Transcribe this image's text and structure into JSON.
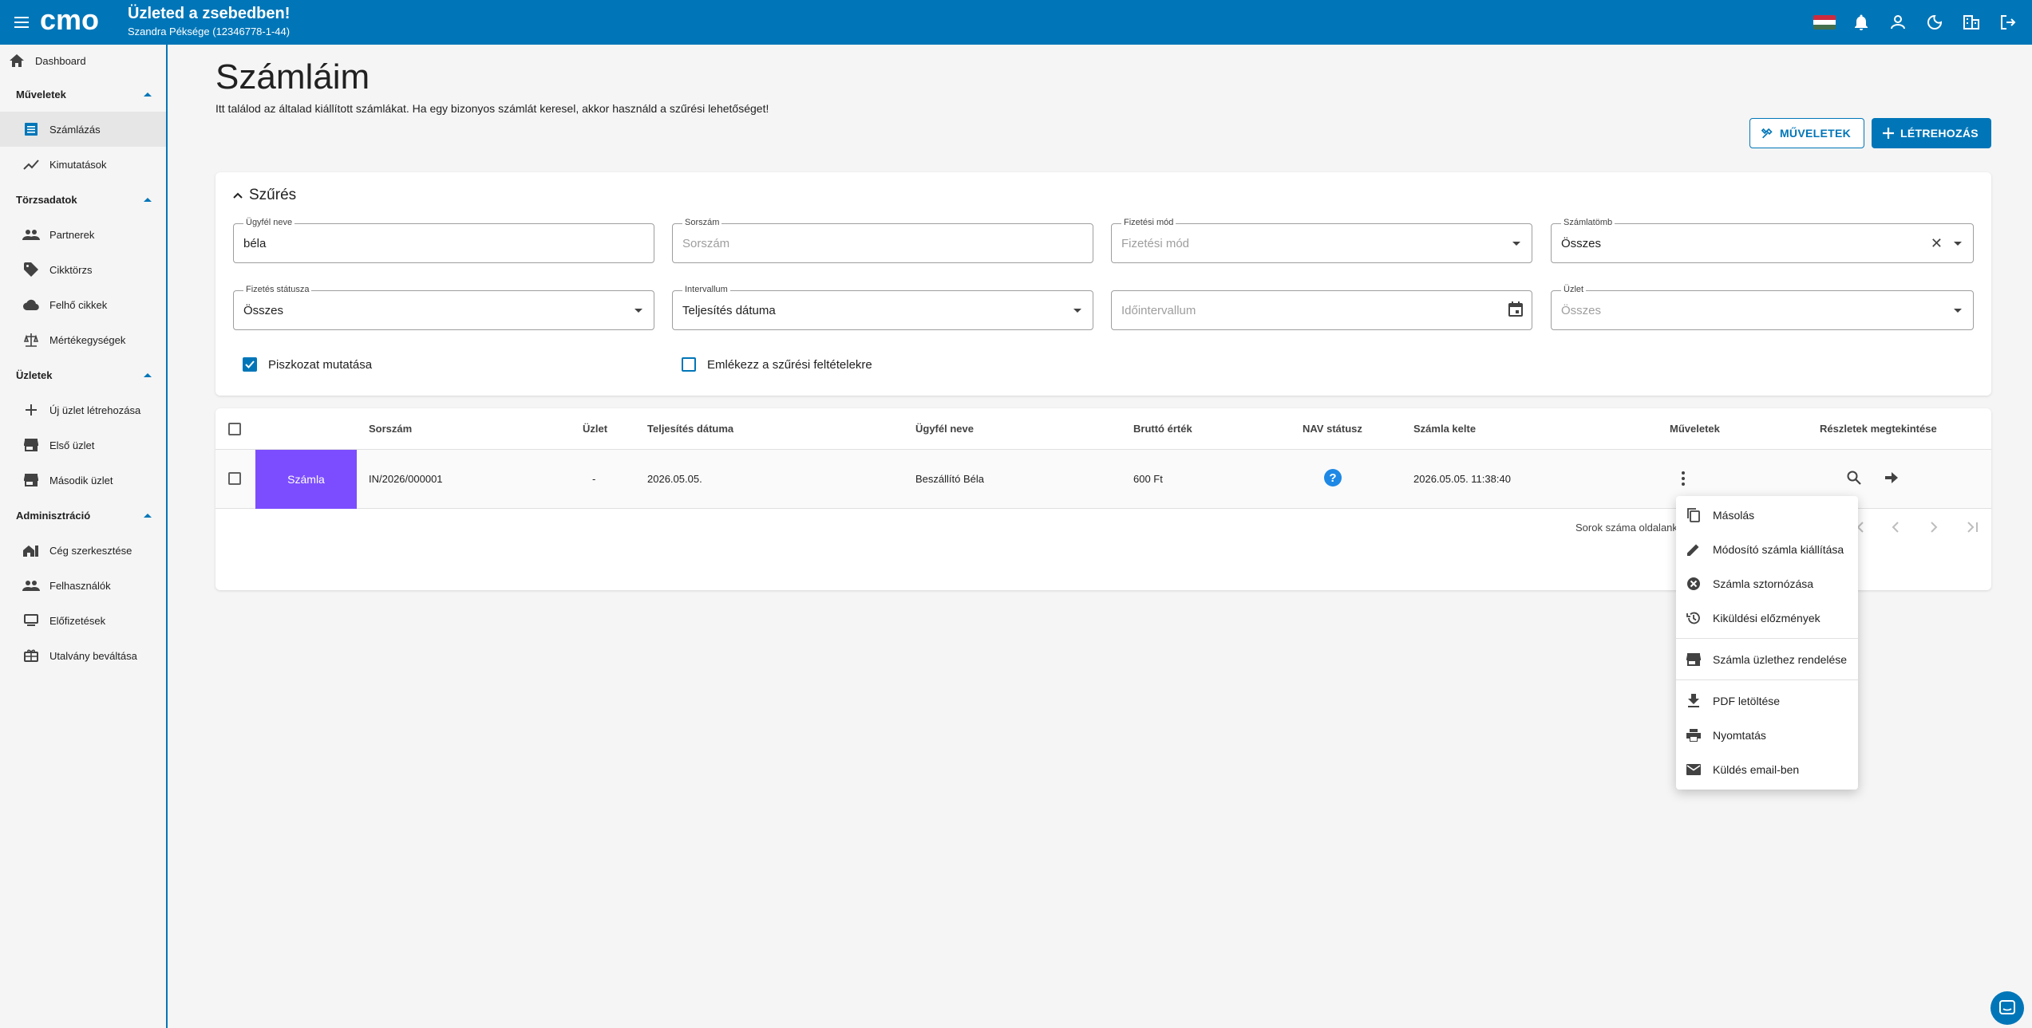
{
  "header": {
    "title": "Üzleted a zsebedben!",
    "subtitle": "Szandra Péksége (12346778-1-44)",
    "logo_text": "cmo",
    "brand_color": "#0076b8",
    "icons": [
      "hungarian-flag-icon",
      "bell-icon",
      "account-icon",
      "dark-mode-icon",
      "company-icon",
      "logout-icon"
    ]
  },
  "sidebar": {
    "dashboard": "Dashboard",
    "sections": [
      {
        "label": "Műveletek",
        "items": [
          "Számlázás",
          "Kimutatások"
        ]
      },
      {
        "label": "Törzsadatok",
        "items": [
          "Partnerek",
          "Cikktörzs",
          "Felhő cikkek",
          "Mértékegységek"
        ]
      },
      {
        "label": "Üzletek",
        "items": [
          "Új üzlet létrehozása",
          "Első üzlet",
          "Második üzlet"
        ]
      },
      {
        "label": "Adminisztráció",
        "items": [
          "Cég szerkesztése",
          "Felhasználók",
          "Előfizetések",
          "Utalvány beváltása"
        ]
      }
    ]
  },
  "page": {
    "title": "Számláim",
    "description": "Itt találod az általad kiállított számlákat. Ha egy bizonyos számlát keresel, akkor használd a szűrési lehetőséget!",
    "actions_button": "MŰVELETEK",
    "create_button": "LÉTREHOZÁS"
  },
  "filter": {
    "heading": "Szűrés",
    "customer_name": {
      "label": "Ügyfél neve",
      "value": "béla"
    },
    "serial": {
      "label": "Sorszám",
      "placeholder": "Sorszám"
    },
    "payment_method": {
      "label": "Fizetési mód",
      "placeholder": "Fizetési mód"
    },
    "invoice_block": {
      "label": "Számlatömb",
      "value": "Összes"
    },
    "payment_status": {
      "label": "Fizetés státusza",
      "value": "Összes"
    },
    "interval": {
      "label": "Intervallum",
      "value": "Teljesítés dátuma"
    },
    "time_interval": {
      "placeholder": "Időintervallum"
    },
    "shop": {
      "label": "Üzlet",
      "placeholder": "Összes"
    },
    "show_drafts": {
      "label": "Piszkozat mutatása",
      "checked": true
    },
    "remember_filters": {
      "label": "Emlékezz a szűrési feltételekre",
      "checked": false
    }
  },
  "table": {
    "headers": {
      "serial": "Sorszám",
      "shop": "Üzlet",
      "fulfillment_date": "Teljesítés dátuma",
      "customer": "Ügyfél neve",
      "gross": "Bruttó érték",
      "nav_status": "NAV státusz",
      "invoice_date": "Számla kelte",
      "actions": "Műveletek",
      "details": "Részletek megtekintése"
    },
    "rows": [
      {
        "type": "Számla",
        "type_color": "#7c4dff",
        "serial": "IN/2026/000001",
        "shop": "-",
        "fulfillment_date": "2026.05.05.",
        "customer": "Beszállító Béla",
        "gross": "600 Ft",
        "nav_status_icon": "question-icon",
        "invoice_date": "2026.05.05. 11:38:40"
      }
    ],
    "footer": {
      "rows_per_page_label": "Sorok száma oldalank"
    }
  },
  "context_menu": {
    "items": [
      {
        "label": "Másolás",
        "icon": "copy-icon"
      },
      {
        "label": "Módosító számla kiállítása",
        "icon": "pencil-icon"
      },
      {
        "label": "Számla sztornózása",
        "icon": "cancel-icon"
      },
      {
        "label": "Kiküldési előzmények",
        "icon": "history-icon"
      },
      {
        "label": "Számla üzlethez rendelése",
        "icon": "store-icon"
      },
      {
        "label": "PDF letöltése",
        "icon": "download-icon"
      },
      {
        "label": "Nyomtatás",
        "icon": "print-icon"
      },
      {
        "label": "Küldés email-ben",
        "icon": "email-icon"
      }
    ]
  }
}
